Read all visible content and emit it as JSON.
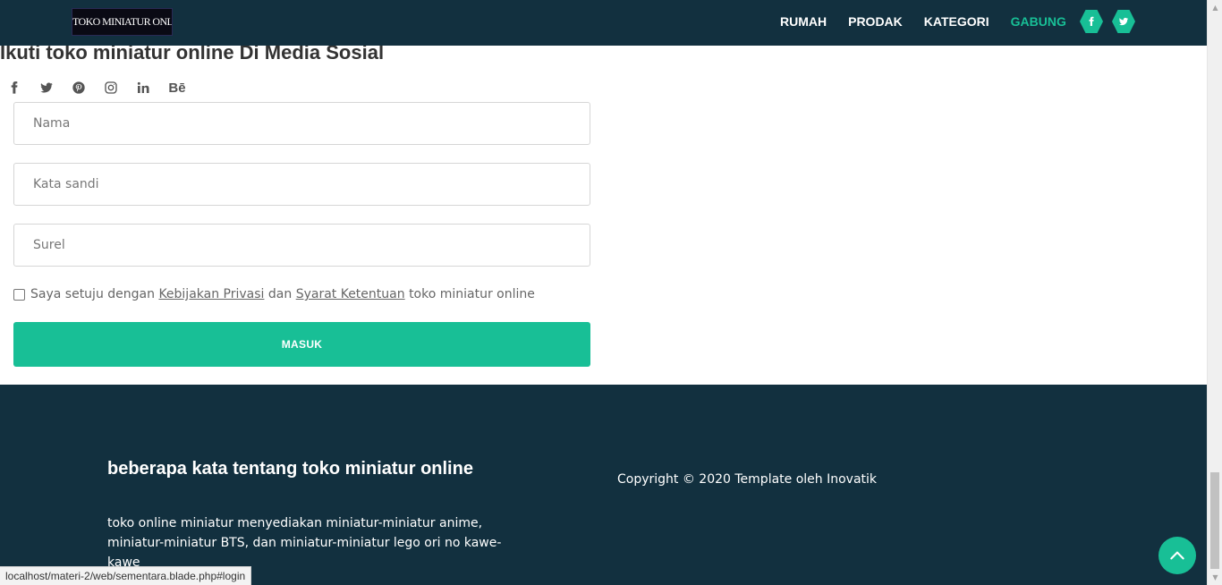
{
  "header": {
    "logo_text": "TOKO MINIATUR ONLINE",
    "nav": [
      "RUMAH",
      "PRODAK",
      "KATEGORI",
      "GABUNG"
    ],
    "active_nav": "GABUNG",
    "social_icons": [
      "facebook-icon",
      "twitter-icon"
    ],
    "accent_color": "#18bf96",
    "bg_color": "#12303f"
  },
  "follow": {
    "title": "Ikuti toko miniatur online Di Media Sosial",
    "icons": [
      "facebook-icon",
      "twitter-icon",
      "pinterest-icon",
      "instagram-icon",
      "linkedin-icon",
      "behance-icon"
    ],
    "behance_text": "Bē"
  },
  "form": {
    "name_placeholder": "Nama",
    "password_placeholder": "Kata sandi",
    "email_placeholder": "Surel",
    "agree_prefix": "Saya setuju dengan",
    "privacy_link": "Kebijakan Privasi",
    "agree_and": "dan",
    "terms_link": "Syarat Ketentuan",
    "agree_suffix": "toko miniatur online",
    "submit_label": "MASUK"
  },
  "footer": {
    "about_title": "beberapa kata tentang toko miniatur online",
    "about_text": "toko online miniatur menyediakan miniatur-miniatur anime, miniatur-miniatur BTS, dan miniatur-miniatur lego ori no kawe-kawe",
    "copyright": "Copyright © 2020 Template oleh Inovatik"
  },
  "status_bar": {
    "url": "localhost/materi-2/web/sementara.blade.php#login"
  }
}
